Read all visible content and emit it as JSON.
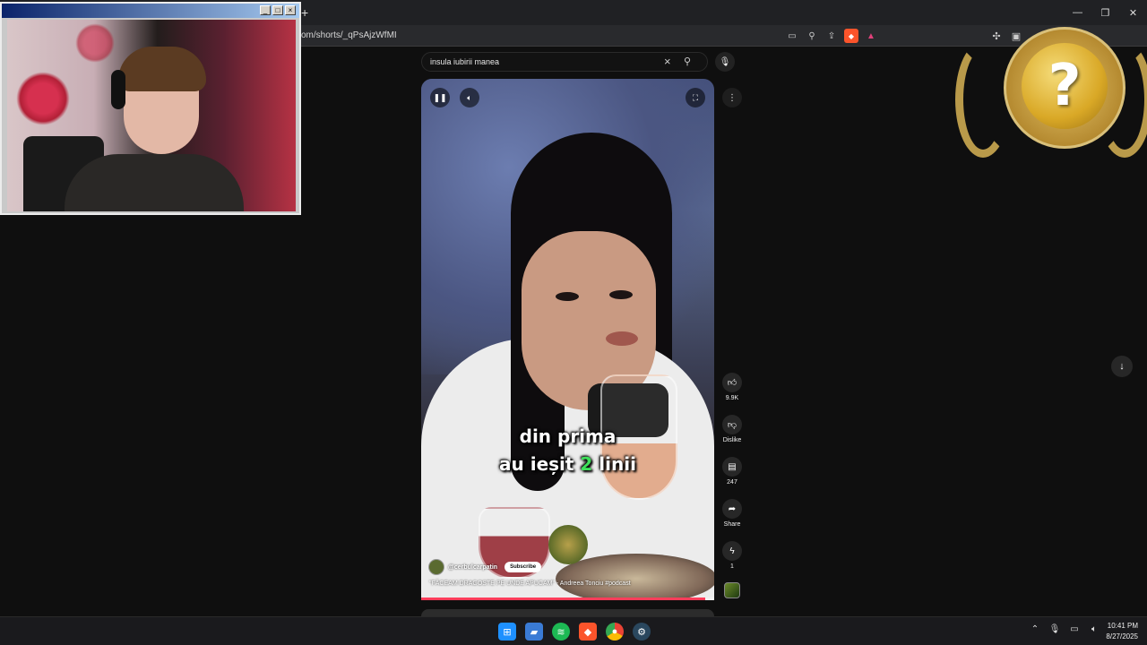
{
  "browser": {
    "url": "om/shorts/_qPsAjzWfMI",
    "new_tab_icon": "plus-icon",
    "toolbar_icons": [
      "cast-icon",
      "zoom-icon",
      "share-icon",
      "brave-shield-icon",
      "brave-rewards-icon"
    ],
    "right_icons": [
      "extensions-icon",
      "sidepanel-icon",
      "wallet-icon",
      "bookmark-star-icon",
      "vpn-shield-icon",
      "menu-icon"
    ],
    "window_controls": [
      "minimize-icon",
      "restore-icon",
      "close-icon"
    ]
  },
  "webcam": {
    "titlebar_buttons": [
      "minimize-icon",
      "maximize-icon",
      "close-icon"
    ]
  },
  "search": {
    "query": "insula iubirii manea",
    "clear_icon": "close-icon",
    "search_icon": "search-icon",
    "mic_icon": "microphone-icon"
  },
  "player": {
    "caption_line1": "din prima",
    "caption_line2_a": "au ieșit ",
    "caption_line2_highlight": "2",
    "caption_line2_b": " linii",
    "channel_handle": "@cerbulcarpatin",
    "subscribe_label": "Subscribe",
    "video_title": "\"FĂCEAM DRAGOSTE PE UNDE APUCAM\" - Andreea Tonciu #podcast",
    "progress_fraction": 0.97,
    "accent_color": "#ff3d5a"
  },
  "actions": {
    "like_count": "9.9K",
    "dislike_label": "Dislike",
    "comment_count": "247",
    "share_label": "Share",
    "remix_count": "1"
  },
  "taskbar": {
    "apps": [
      "windows-start-icon",
      "file-explorer-icon",
      "spotify-icon",
      "brave-browser-icon",
      "chrome-icon",
      "steam-icon"
    ],
    "time": "10:41 PM",
    "date": "8/27/2025"
  }
}
